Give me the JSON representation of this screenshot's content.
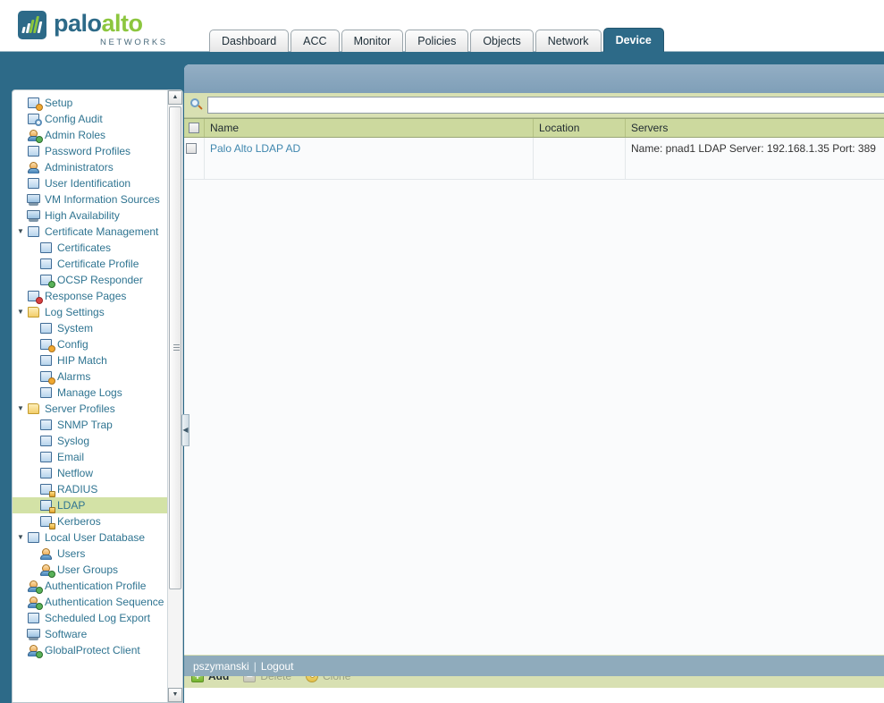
{
  "brand": {
    "name_part1": "palo",
    "name_part2": "alto",
    "tagline": "NETWORKS",
    "logo_icon": "bar-chart-logo-icon",
    "accent_blue": "#2d6a88",
    "accent_green": "#8cc63e"
  },
  "tabs": [
    {
      "label": "Dashboard",
      "active": false
    },
    {
      "label": "ACC",
      "active": false
    },
    {
      "label": "Monitor",
      "active": false
    },
    {
      "label": "Policies",
      "active": false
    },
    {
      "label": "Objects",
      "active": false
    },
    {
      "label": "Network",
      "active": false
    },
    {
      "label": "Device",
      "active": true
    }
  ],
  "sidebar": {
    "items": [
      {
        "label": "Setup",
        "icon": "setup-gear-icon",
        "level": 0,
        "arrow": "",
        "selected": false
      },
      {
        "label": "Config Audit",
        "icon": "config-audit-icon",
        "level": 0,
        "arrow": "",
        "selected": false
      },
      {
        "label": "Admin Roles",
        "icon": "admin-roles-icon",
        "level": 0,
        "arrow": "",
        "selected": false
      },
      {
        "label": "Password Profiles",
        "icon": "password-profiles-icon",
        "level": 0,
        "arrow": "",
        "selected": false
      },
      {
        "label": "Administrators",
        "icon": "administrators-icon",
        "level": 0,
        "arrow": "",
        "selected": false
      },
      {
        "label": "User Identification",
        "icon": "user-identification-icon",
        "level": 0,
        "arrow": "",
        "selected": false
      },
      {
        "label": "VM Information Sources",
        "icon": "vm-information-sources-icon",
        "level": 0,
        "arrow": "",
        "selected": false
      },
      {
        "label": "High Availability",
        "icon": "high-availability-icon",
        "level": 0,
        "arrow": "",
        "selected": false
      },
      {
        "label": "Certificate Management",
        "icon": "certificate-management-icon",
        "level": 0,
        "arrow": "▼",
        "selected": false
      },
      {
        "label": "Certificates",
        "icon": "certificates-icon",
        "level": 1,
        "arrow": "",
        "selected": false
      },
      {
        "label": "Certificate Profile",
        "icon": "certificate-profile-icon",
        "level": 1,
        "arrow": "",
        "selected": false
      },
      {
        "label": "OCSP Responder",
        "icon": "ocsp-responder-icon",
        "level": 1,
        "arrow": "",
        "selected": false
      },
      {
        "label": "Response Pages",
        "icon": "response-pages-icon",
        "level": 0,
        "arrow": "",
        "selected": false
      },
      {
        "label": "Log Settings",
        "icon": "log-settings-folder-icon",
        "level": 0,
        "arrow": "▼",
        "selected": false
      },
      {
        "label": "System",
        "icon": "system-log-icon",
        "level": 1,
        "arrow": "",
        "selected": false
      },
      {
        "label": "Config",
        "icon": "config-log-icon",
        "level": 1,
        "arrow": "",
        "selected": false
      },
      {
        "label": "HIP Match",
        "icon": "hip-match-icon",
        "level": 1,
        "arrow": "",
        "selected": false
      },
      {
        "label": "Alarms",
        "icon": "alarms-icon",
        "level": 1,
        "arrow": "",
        "selected": false
      },
      {
        "label": "Manage Logs",
        "icon": "manage-logs-icon",
        "level": 1,
        "arrow": "",
        "selected": false
      },
      {
        "label": "Server Profiles",
        "icon": "server-profiles-folder-icon",
        "level": 0,
        "arrow": "▼",
        "selected": false
      },
      {
        "label": "SNMP Trap",
        "icon": "snmp-trap-icon",
        "level": 1,
        "arrow": "",
        "selected": false
      },
      {
        "label": "Syslog",
        "icon": "syslog-icon",
        "level": 1,
        "arrow": "",
        "selected": false
      },
      {
        "label": "Email",
        "icon": "email-icon",
        "level": 1,
        "arrow": "",
        "selected": false
      },
      {
        "label": "Netflow",
        "icon": "netflow-icon",
        "level": 1,
        "arrow": "",
        "selected": false
      },
      {
        "label": "RADIUS",
        "icon": "radius-lock-icon",
        "level": 1,
        "arrow": "",
        "selected": false
      },
      {
        "label": "LDAP",
        "icon": "ldap-lock-icon",
        "level": 1,
        "arrow": "",
        "selected": true
      },
      {
        "label": "Kerberos",
        "icon": "kerberos-lock-icon",
        "level": 1,
        "arrow": "",
        "selected": false
      },
      {
        "label": "Local User Database",
        "icon": "local-user-database-icon",
        "level": 0,
        "arrow": "▼",
        "selected": false
      },
      {
        "label": "Users",
        "icon": "users-icon",
        "level": 1,
        "arrow": "",
        "selected": false
      },
      {
        "label": "User Groups",
        "icon": "user-groups-icon",
        "level": 1,
        "arrow": "",
        "selected": false
      },
      {
        "label": "Authentication Profile",
        "icon": "authentication-profile-icon",
        "level": 0,
        "arrow": "",
        "selected": false
      },
      {
        "label": "Authentication Sequence",
        "icon": "authentication-sequence-icon",
        "level": 0,
        "arrow": "",
        "selected": false
      },
      {
        "label": "Scheduled Log Export",
        "icon": "scheduled-log-export-icon",
        "level": 0,
        "arrow": "",
        "selected": false
      },
      {
        "label": "Software",
        "icon": "software-icon",
        "level": 0,
        "arrow": "",
        "selected": false
      },
      {
        "label": "GlobalProtect Client",
        "icon": "globalprotect-client-icon",
        "level": 0,
        "arrow": "",
        "selected": false
      }
    ],
    "scroll_up_icon": "▲",
    "scroll_down_icon": "▼",
    "collapse_icon": "◀"
  },
  "search": {
    "value": "",
    "placeholder": "",
    "icon": "search-icon"
  },
  "table": {
    "columns": [
      "Name",
      "Location",
      "Servers"
    ],
    "rows": [
      {
        "name": "Palo Alto LDAP AD",
        "location": "",
        "servers": "Name: pnad1 LDAP Server: 192.168.1.35 Port: 389"
      }
    ]
  },
  "actions": [
    {
      "label": "Add",
      "icon": "plus-icon",
      "glyph": "+",
      "enabled": true
    },
    {
      "label": "Delete",
      "icon": "minus-icon",
      "glyph": "−",
      "enabled": false
    },
    {
      "label": "Clone",
      "icon": "clone-icon",
      "glyph": "",
      "enabled": false
    }
  ],
  "status": {
    "user": "pszymanski",
    "separator": "|",
    "logout_label": "Logout"
  }
}
